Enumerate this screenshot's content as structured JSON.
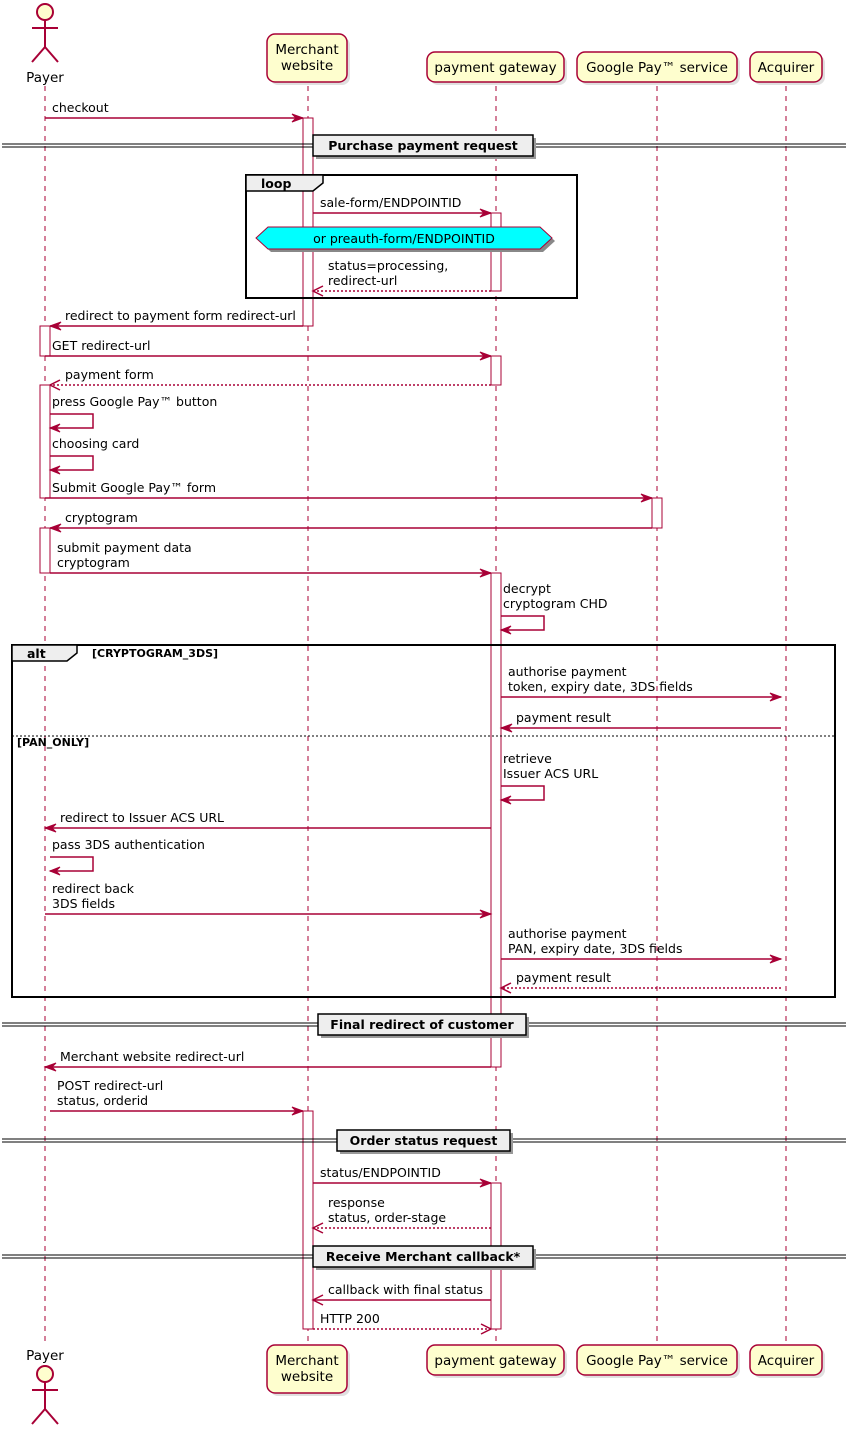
{
  "colors": {
    "line": "#A80036",
    "participant_fill": "#FEFECE",
    "note_fill": "#00FFFF",
    "frame_fill": "#EEEEEE"
  },
  "participants": [
    {
      "id": "payer",
      "label": [
        "Payer"
      ],
      "kind": "actor"
    },
    {
      "id": "merchant",
      "label": [
        "Merchant",
        "website"
      ],
      "kind": "participant"
    },
    {
      "id": "gateway",
      "label": [
        "payment gateway"
      ],
      "kind": "participant"
    },
    {
      "id": "google",
      "label": [
        "Google Pay™ service"
      ],
      "kind": "participant"
    },
    {
      "id": "acquirer",
      "label": [
        "Acquirer"
      ],
      "kind": "participant"
    }
  ],
  "messages": [
    {
      "from": "payer",
      "to": "merchant",
      "text": [
        "checkout"
      ],
      "style": "solid"
    },
    {
      "from": "merchant",
      "to": "gateway",
      "text": [
        "sale-form/ENDPOINTID"
      ],
      "style": "solid"
    },
    {
      "from": "gateway",
      "to": "merchant",
      "text": [
        "status=processing,",
        "redirect-url"
      ],
      "style": "dashed"
    },
    {
      "from": "merchant",
      "to": "payer",
      "text": [
        "redirect to payment form redirect-url"
      ],
      "style": "solid"
    },
    {
      "from": "payer",
      "to": "gateway",
      "text": [
        "GET redirect-url"
      ],
      "style": "solid"
    },
    {
      "from": "gateway",
      "to": "payer",
      "text": [
        "payment form"
      ],
      "style": "dashed"
    },
    {
      "from": "payer",
      "to": "payer",
      "text": [
        "press Google Pay™ button"
      ],
      "style": "solid"
    },
    {
      "from": "payer",
      "to": "payer",
      "text": [
        "choosing card"
      ],
      "style": "solid"
    },
    {
      "from": "payer",
      "to": "google",
      "text": [
        "Submit Google Pay™ form"
      ],
      "style": "solid"
    },
    {
      "from": "google",
      "to": "payer",
      "text": [
        "cryptogram"
      ],
      "style": "solid"
    },
    {
      "from": "payer",
      "to": "gateway",
      "text": [
        "submit payment data",
        "cryptogram"
      ],
      "style": "solid"
    },
    {
      "from": "gateway",
      "to": "gateway",
      "text": [
        "decrypt",
        "cryptogram CHD"
      ],
      "style": "solid"
    },
    {
      "from": "gateway",
      "to": "acquirer",
      "text": [
        "authorise payment",
        "token, expiry date, 3DS fields"
      ],
      "style": "solid"
    },
    {
      "from": "acquirer",
      "to": "gateway",
      "text": [
        "payment result"
      ],
      "style": "solid"
    },
    {
      "from": "gateway",
      "to": "gateway",
      "text": [
        "retrieve",
        "Issuer ACS URL"
      ],
      "style": "solid"
    },
    {
      "from": "gateway",
      "to": "payer",
      "text": [
        "redirect to Issuer ACS URL"
      ],
      "style": "solid"
    },
    {
      "from": "payer",
      "to": "payer",
      "text": [
        "pass 3DS authentication"
      ],
      "style": "solid"
    },
    {
      "from": "payer",
      "to": "gateway",
      "text": [
        "redirect back",
        "3DS fields"
      ],
      "style": "solid"
    },
    {
      "from": "gateway",
      "to": "acquirer",
      "text": [
        "authorise payment",
        "PAN, expiry date, 3DS fields"
      ],
      "style": "solid"
    },
    {
      "from": "acquirer",
      "to": "gateway",
      "text": [
        "payment result"
      ],
      "style": "dashed"
    },
    {
      "from": "gateway",
      "to": "payer",
      "text": [
        "Merchant website redirect-url"
      ],
      "style": "solid"
    },
    {
      "from": "payer",
      "to": "merchant",
      "text": [
        "POST redirect-url",
        "status, orderid"
      ],
      "style": "solid"
    },
    {
      "from": "merchant",
      "to": "gateway",
      "text": [
        "status/ENDPOINTID"
      ],
      "style": "solid"
    },
    {
      "from": "gateway",
      "to": "merchant",
      "text": [
        "response",
        "status, order-stage"
      ],
      "style": "dashed"
    },
    {
      "from": "gateway",
      "to": "merchant",
      "text": [
        "callback with final status"
      ],
      "style": "open"
    },
    {
      "from": "merchant",
      "to": "gateway",
      "text": [
        "HTTP 200"
      ],
      "style": "dashed"
    }
  ],
  "dividers": [
    "Purchase payment request",
    "Final redirect of customer",
    "Order status request",
    "Receive Merchant callback*"
  ],
  "note": "or preauth-form/ENDPOINTID",
  "loop_frame": {
    "label": "loop"
  },
  "alt_frame": {
    "label": "alt",
    "guard": "[CRYPTOGRAM_3DS]",
    "else_guard": "[PAN_ONLY]"
  }
}
